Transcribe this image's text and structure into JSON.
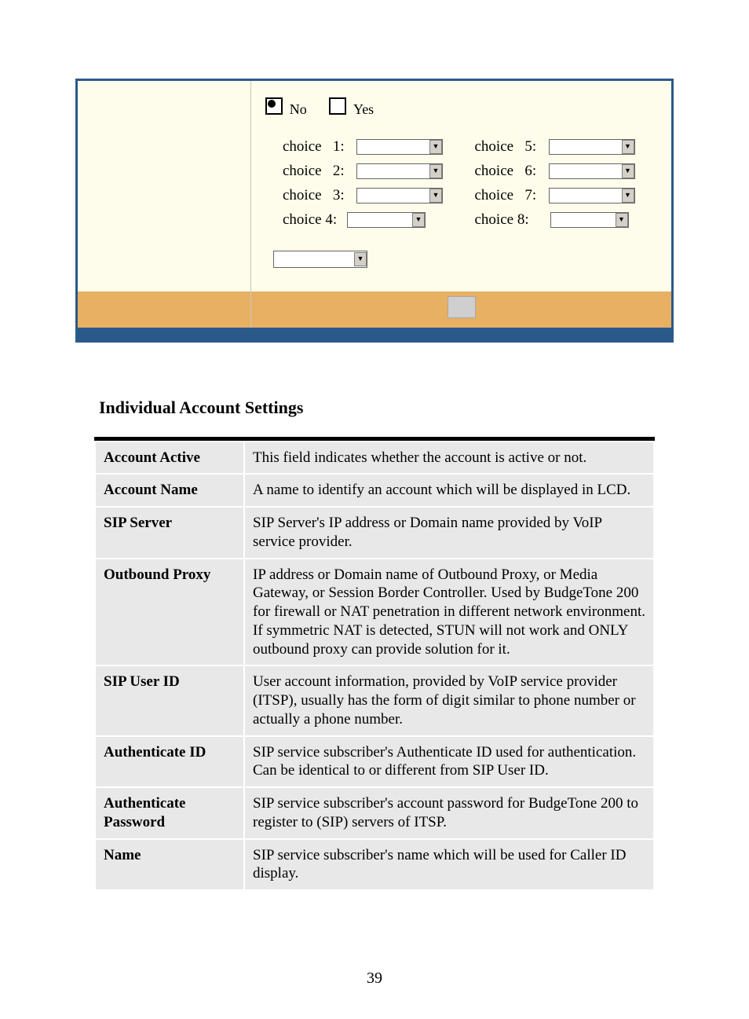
{
  "config": {
    "radio_no": "No",
    "radio_yes": "Yes",
    "choices": {
      "c1": "choice   1:",
      "c2": "choice   2:",
      "c3": "choice   3:",
      "c4": "choice 4:",
      "c5": "choice   5:",
      "c6": "choice   6:",
      "c7": "choice   7:",
      "c8": "choice 8:"
    }
  },
  "section_heading": "Individual Account Settings",
  "settings": [
    {
      "label": "Account Active",
      "desc": "This field indicates whether the account is active or not."
    },
    {
      "label": "Account Name",
      "desc": "A name to identify an account which will be displayed in LCD."
    },
    {
      "label": "SIP Server",
      "desc": "SIP Server's IP address or Domain name provided by VoIP service provider."
    },
    {
      "label": "Outbound Proxy",
      "desc": "IP address or Domain name of Outbound Proxy, or Media Gateway, or Session Border Controller. Used by BudgeTone 200 for firewall or NAT penetration in different network environment. If symmetric NAT is detected, STUN will not work and ONLY outbound proxy can provide solution for it."
    },
    {
      "label": "SIP User ID",
      "desc": "User account information, provided by VoIP service provider (ITSP), usually has the form of digit similar to phone number or actually a phone number."
    },
    {
      "label": "Authenticate ID",
      "desc": "SIP service subscriber's Authenticate ID used for authentication. Can be identical to or different from SIP User ID."
    },
    {
      "label": "Authenticate Password",
      "desc": "SIP service subscriber's account password for BudgeTone 200 to register to (SIP) servers of ITSP."
    },
    {
      "label": "Name",
      "desc": "SIP service subscriber's name which will be used for Caller ID display."
    }
  ],
  "page_number": "39"
}
